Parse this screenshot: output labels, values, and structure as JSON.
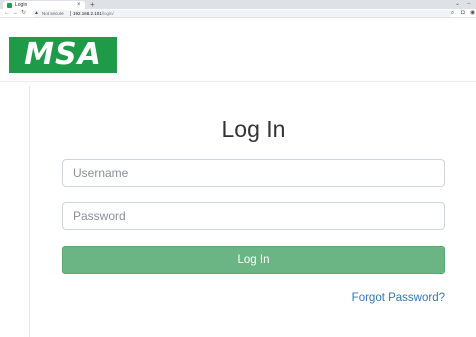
{
  "browser": {
    "tab_title": "Login",
    "tab_close": "×",
    "new_tab": "+",
    "security_label": "Not secure",
    "url_host": "192.168.2.101",
    "url_path": "/login/"
  },
  "header": {
    "logo_text": "MSA"
  },
  "login": {
    "title": "Log In",
    "username_placeholder": "Username",
    "password_placeholder": "Password",
    "submit_label": "Log In",
    "forgot_label": "Forgot Password?"
  },
  "colors": {
    "brand_green": "#1f9a48",
    "button_green": "#6bb585",
    "link_blue": "#2f78b7"
  },
  "icons": [
    "back-arrow-icon",
    "forward-arrow-icon",
    "reload-icon",
    "warning-icon",
    "zoom-icon",
    "extension-icon",
    "profile-icon",
    "chevron-down-icon",
    "minimize-icon"
  ]
}
